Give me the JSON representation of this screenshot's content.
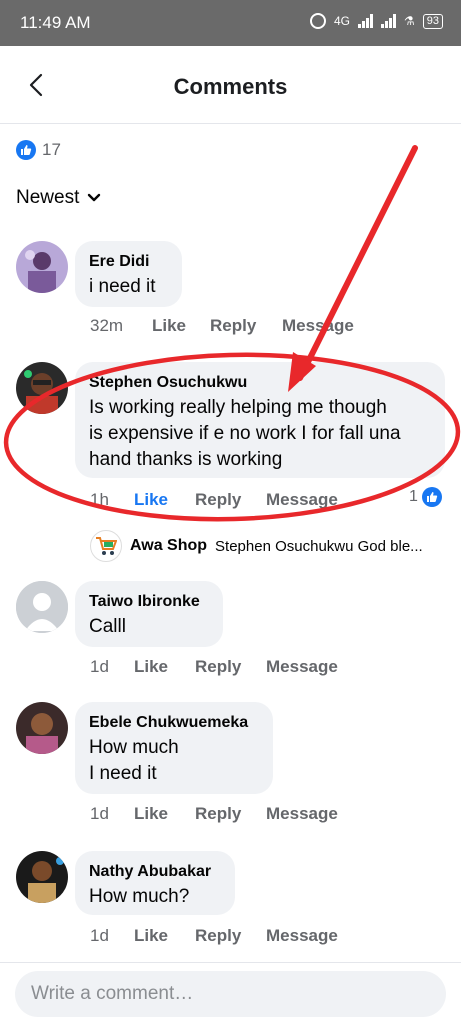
{
  "status_bar": {
    "time": "11:49 AM",
    "network": "4G",
    "battery": "93"
  },
  "header": {
    "title": "Comments"
  },
  "reactions": {
    "count": "17"
  },
  "sort": {
    "label": "Newest"
  },
  "comments": [
    {
      "name": "Ere Didi",
      "text": "i need it",
      "time": "32m",
      "like": "Like",
      "reply": "Reply",
      "message": "Message"
    },
    {
      "name": "Stephen Osuchukwu",
      "lines": [
        "Is working really helping me though",
        "is expensive if e no work I for fall una",
        "hand thanks is working"
      ],
      "time": "1h",
      "like": "Like",
      "reply": "Reply",
      "message": "Message",
      "reaction_count": "1",
      "reply_preview": {
        "name": "Awa Shop",
        "text": "Stephen Osuchukwu God ble..."
      }
    },
    {
      "name": "Taiwo Ibironke",
      "text": "Calll",
      "time": "1d",
      "like": "Like",
      "reply": "Reply",
      "message": "Message"
    },
    {
      "name": "Ebele Chukwuemeka",
      "lines": [
        "How much",
        "I need it"
      ],
      "time": "1d",
      "like": "Like",
      "reply": "Reply",
      "message": "Message"
    },
    {
      "name": "Nathy Abubakar",
      "text": "How much?",
      "time": "1d",
      "like": "Like",
      "reply": "Reply",
      "message": "Message"
    }
  ],
  "composer": {
    "placeholder": "Write a comment…"
  },
  "colors": {
    "accent": "#1877f2",
    "bubble": "#f0f2f5",
    "annotation": "#e8282b"
  }
}
